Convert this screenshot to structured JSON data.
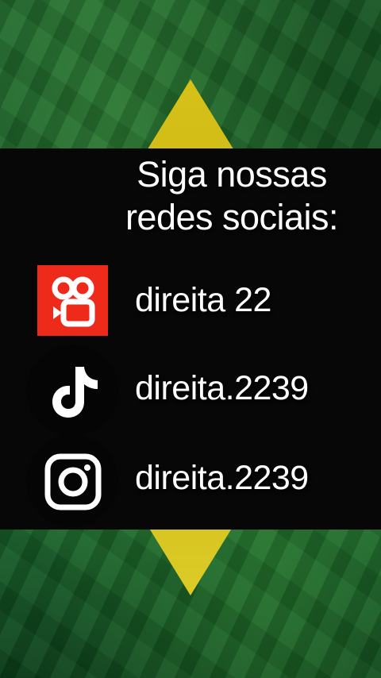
{
  "heading": {
    "line1": "Siga nossas",
    "line2": "redes sociais:"
  },
  "social": [
    {
      "icon": "kwai-icon",
      "handle": "direita 22"
    },
    {
      "icon": "tiktok-icon",
      "handle": "direita.2239"
    },
    {
      "icon": "instagram-icon",
      "handle": "direita.2239"
    }
  ],
  "colors": {
    "panel": "#070707",
    "kwai": "#ee2a1b",
    "flag_green": "#1b5e2a",
    "flag_yellow": "#e8d21a"
  }
}
